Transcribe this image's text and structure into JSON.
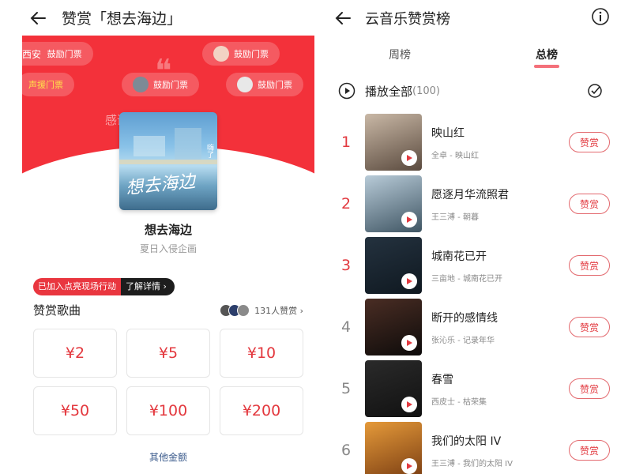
{
  "left": {
    "header": {
      "title": "赞赏「想去海边」"
    },
    "banner": {
      "chips": [
        {
          "name": "西安",
          "action": "鼓励门票",
          "style": "plain"
        },
        {
          "name": "",
          "action": "鼓励门票",
          "style": "avatar"
        },
        {
          "name": "",
          "action": "声援门票",
          "style": "yellow"
        },
        {
          "name": "",
          "action": "鼓励门票",
          "style": "avatar"
        },
        {
          "name": "",
          "action": "鼓励门票",
          "style": "avatar"
        }
      ],
      "message": "感谢支持!"
    },
    "cover": {
      "art_text": "想去海边",
      "side_text": "嗨了"
    },
    "song": {
      "title": "想去海边",
      "artist": "夏日入侵企画"
    },
    "campaign": {
      "tag": "已加入点亮现场行动",
      "link": "了解详情 ›"
    },
    "section": {
      "title": "赞赏歌曲",
      "supporters": "131人赞赏 ›"
    },
    "amounts": [
      "¥2",
      "¥5",
      "¥10",
      "¥50",
      "¥100",
      "¥200"
    ],
    "other_amount": "其他金额"
  },
  "right": {
    "header": {
      "title": "云音乐赞赏榜"
    },
    "tabs": [
      {
        "label": "周榜",
        "active": false
      },
      {
        "label": "总榜",
        "active": true
      }
    ],
    "play_all": {
      "label": "播放全部",
      "count": "(100)"
    },
    "tip_label": "赞赏",
    "songs": [
      {
        "rank": "1",
        "title": "映山红",
        "subtitle": "全卓 - 映山红",
        "thumb": [
          "#c9b8a6",
          "#5a4a3e"
        ]
      },
      {
        "rank": "2",
        "title": "愿逐月华流照君",
        "subtitle": "王三溥 - 朝暮",
        "thumb": [
          "#b8cbd8",
          "#3f5563"
        ]
      },
      {
        "rank": "3",
        "title": "城南花已开",
        "subtitle": "三亩地 - 城南花已开",
        "thumb": [
          "#24323f",
          "#0f1820"
        ]
      },
      {
        "rank": "4",
        "title": "断开的感情线",
        "subtitle": "张沁乐 - 记录年华",
        "thumb": [
          "#4a2d24",
          "#0d0b0a"
        ]
      },
      {
        "rank": "5",
        "title": "春雪",
        "subtitle": "西皮士 - 枯荣集",
        "thumb": [
          "#2a2a2a",
          "#111111"
        ]
      },
      {
        "rank": "6",
        "title": "我们的太阳 IV",
        "subtitle": "王三溥 - 我们的太阳 IV",
        "thumb": [
          "#e59a3a",
          "#7a3d12"
        ]
      }
    ]
  },
  "colors": {
    "brand_red": "#f3313a",
    "tip_red": "#e23a40",
    "link_blue": "#3b5b8c"
  }
}
